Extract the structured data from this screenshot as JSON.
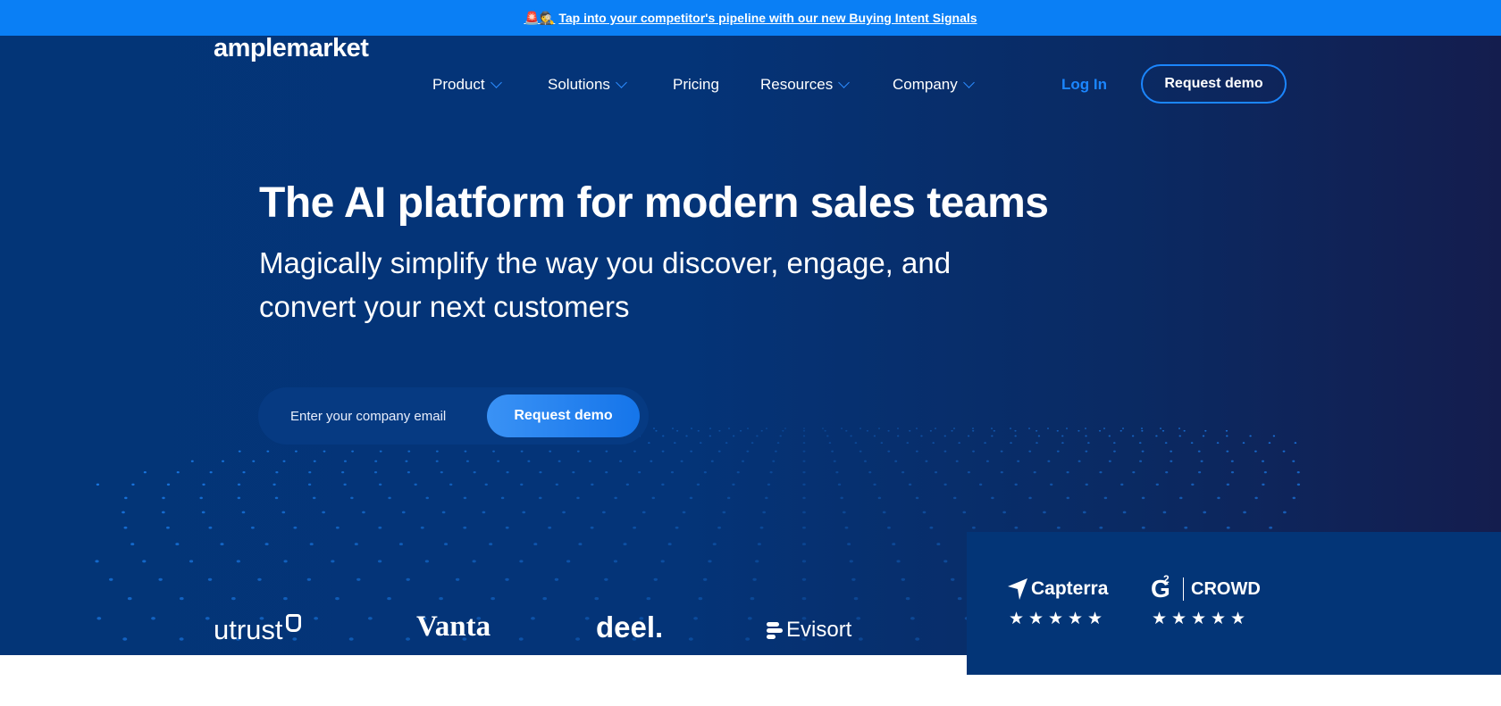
{
  "banner": {
    "emoji": "🚨🕵️",
    "text": "Tap into your competitor's pipeline with our new Buying Intent Signals"
  },
  "nav": {
    "logo": "amplemarket",
    "items": [
      {
        "label": "Product",
        "dropdown": true
      },
      {
        "label": "Solutions",
        "dropdown": true
      },
      {
        "label": "Pricing",
        "dropdown": false
      },
      {
        "label": "Resources",
        "dropdown": true
      },
      {
        "label": "Company",
        "dropdown": true
      }
    ],
    "login_label": "Log In",
    "demo_label": "Request demo"
  },
  "hero": {
    "title": "The AI platform for modern sales teams",
    "subtitle": "Magically simplify the way you discover, engage, and convert your next customers",
    "email_placeholder": "Enter your company email",
    "email_value": "",
    "demo_label": "Request demo"
  },
  "clients": [
    "utrust",
    "Vanta",
    "deel.",
    "Evisort"
  ],
  "reviews": [
    {
      "brand": "Capterra",
      "icon": "capterra-icon",
      "rating": 5
    },
    {
      "brand": "CROWD",
      "icon": "g2-icon",
      "rating": 5
    }
  ],
  "colors": {
    "banner": "#0a7ff5",
    "hero_bg": "#033577",
    "accent": "#1b86ff",
    "white": "#ffffff"
  }
}
